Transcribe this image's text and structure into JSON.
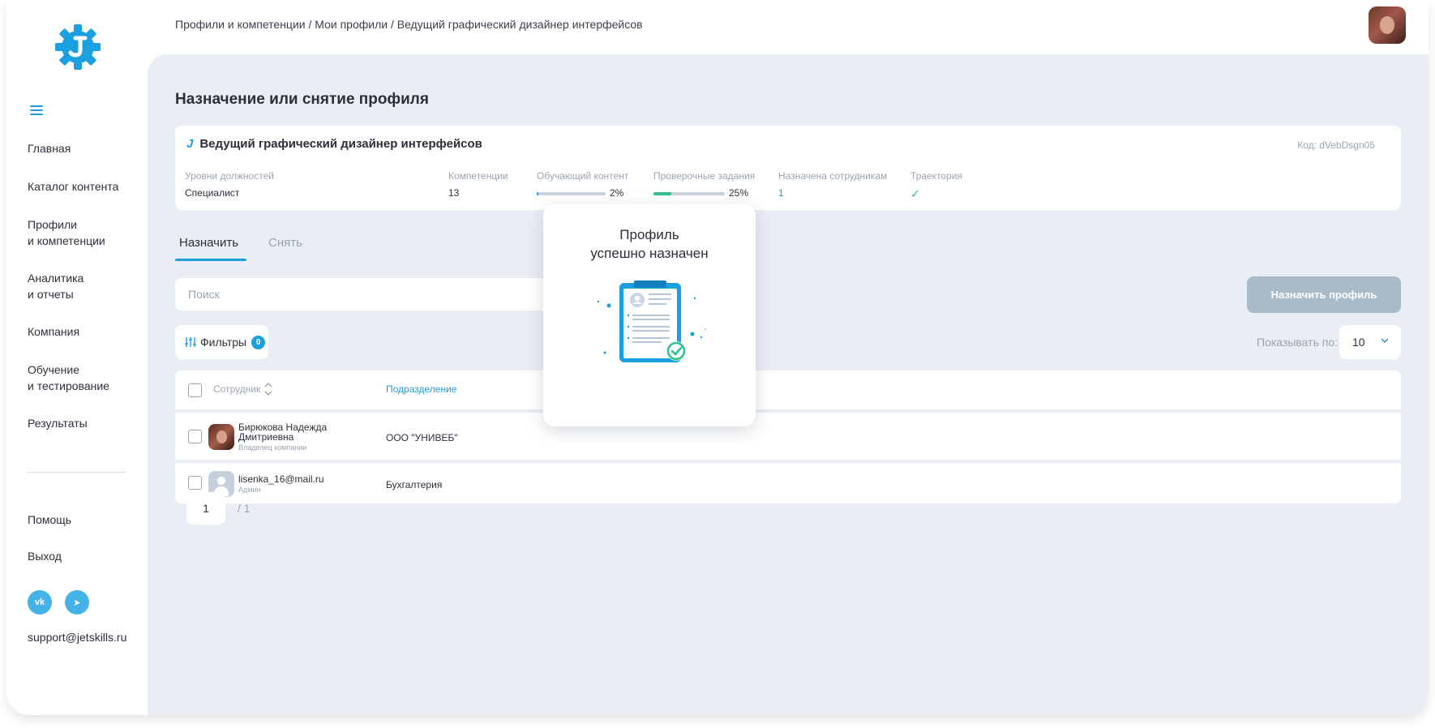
{
  "breadcrumb": "Профили и компетенции / Мои профили / Ведущий графический дизайнер интерфейсов",
  "sidebar": {
    "items": [
      {
        "label": "Главная"
      },
      {
        "label": "Каталог контента"
      },
      {
        "label": "Профили\nи компетенции"
      },
      {
        "label": "Аналитика\nи отчеты"
      },
      {
        "label": "Компания"
      },
      {
        "label": "Обучение\nи тестирование"
      },
      {
        "label": "Результаты"
      }
    ],
    "help": "Помощь",
    "logout": "Выход",
    "vk": "vk",
    "tg": "➤",
    "support_email": "support@jetskills.ru"
  },
  "page": {
    "title": "Назначение или снятие профиля"
  },
  "profile_card": {
    "logo_letter": "J",
    "title": "Ведущий графический дизайнер интерфейсов",
    "code": "Код: dVebDsgn05",
    "columns": {
      "levels_label": "Уровни должностей",
      "levels_value": "Специалист",
      "competencies_label": "Компетенции",
      "competencies_value": "13",
      "content_label": "Обучающий контент",
      "content_pct": "2%",
      "content_fill": 0.02,
      "tasks_label": "Проверочные задания",
      "tasks_pct": "25%",
      "tasks_fill": 0.25,
      "assigned_label": "Назначена сотрудникам",
      "assigned_value": "1",
      "trajectory_label": "Траектория",
      "trajectory_value": "✓"
    },
    "colors": {
      "accent": "#1a9fe0",
      "success": "#2cc18f",
      "track": "#c7d2e0"
    }
  },
  "tabs": [
    {
      "label": "Назначить",
      "active": true
    },
    {
      "label": "Снять",
      "active": false
    }
  ],
  "search": {
    "placeholder": "Поиск"
  },
  "assign_button": "Назначить профиль",
  "filters": {
    "label": "Фильтры",
    "count": "0"
  },
  "page_size": {
    "label": "Показывать по:",
    "value": "10"
  },
  "table": {
    "headers": {
      "employee": "Сотрудник",
      "department": "Подразделение"
    },
    "rows": [
      {
        "name": "Бирюкова Надежда\nДмитриевна",
        "role": "Владелец компании",
        "department": "ООО \"УНИВЕБ\"",
        "avatar": "photo"
      },
      {
        "name": "lisenka_16@mail.ru",
        "role": "Админ",
        "department": "Бухгалтерия",
        "avatar": "placeholder"
      }
    ]
  },
  "pagination": {
    "current": "1",
    "total": "/ 1"
  },
  "modal": {
    "title": "Профиль\nуспешно назначен",
    "icon": "clipboard-success-illustration"
  }
}
